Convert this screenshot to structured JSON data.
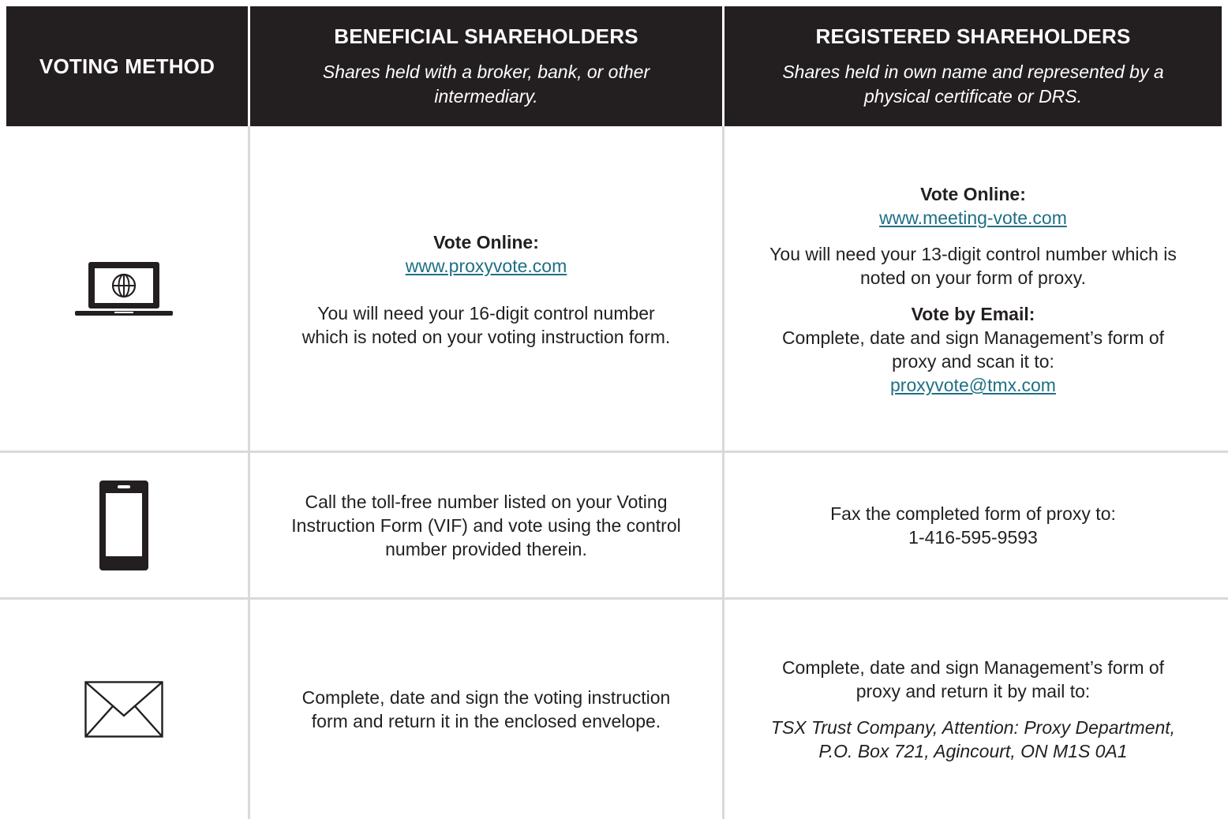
{
  "header": {
    "method": "VOTING METHOD",
    "beneficial_title": "BENEFICIAL SHAREHOLDERS",
    "beneficial_sub_1": "Shares held with a broker, bank, or other",
    "beneficial_sub_2": "intermediary.",
    "registered_title": "REGISTERED SHAREHOLDERS",
    "registered_sub_1": "Shares held in own name and represented by a",
    "registered_sub_2": "physical certificate or DRS."
  },
  "rows": {
    "online": {
      "icon": "laptop-globe-icon",
      "beneficial": {
        "heading": "Vote Online:",
        "link": "www.proxyvote.com",
        "text_1": "You will need your 16-digit control number",
        "text_2": "which is noted on your voting instruction form."
      },
      "registered": {
        "heading": "Vote Online:",
        "link": "www.meeting-vote.com",
        "text_1": "You will need your 13-digit control number which is",
        "text_2": "noted on your form of proxy.",
        "email_heading": "Vote by Email:",
        "email_text_1": "Complete, date and sign Management’s form of",
        "email_text_2": "proxy and scan it to:",
        "email_link": "proxyvote@tmx.com"
      }
    },
    "phone": {
      "icon": "smartphone-icon",
      "beneficial": {
        "text_1": "Call the toll-free number listed on your Voting",
        "text_2": "Instruction Form (VIF) and vote using the control",
        "text_3": "number provided therein."
      },
      "registered": {
        "text_1": "Fax the completed form of proxy to:",
        "text_2": "1-416-595-9593"
      }
    },
    "mail": {
      "icon": "envelope-icon",
      "beneficial": {
        "text_1": "Complete, date and sign the voting instruction",
        "text_2": "form and return it in the enclosed envelope."
      },
      "registered": {
        "text_1": "Complete, date and sign Management’s form of",
        "text_2": "proxy and return it by mail to:",
        "address_1": "TSX Trust Company, Attention: Proxy Department,",
        "address_2": "P.O. Box 721, Agincourt, ON M1S 0A1"
      }
    }
  }
}
